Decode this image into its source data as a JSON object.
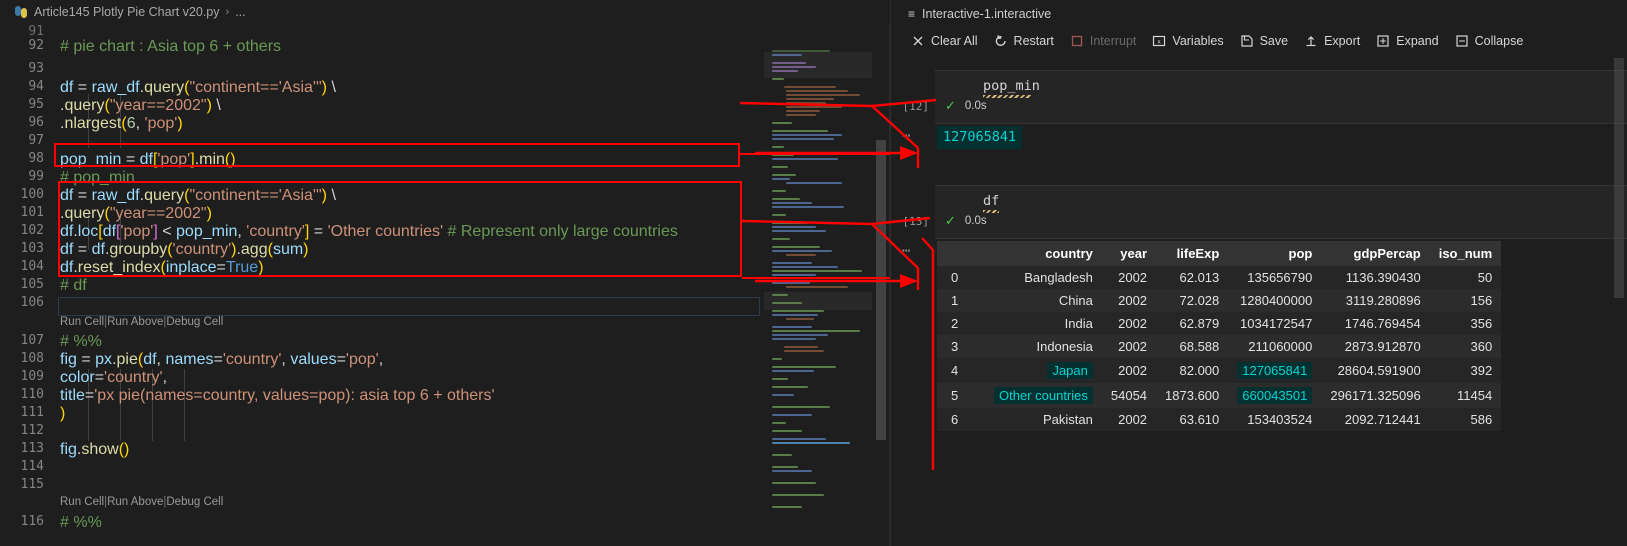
{
  "editor": {
    "breadcrumb": {
      "file": "Article145 Plotly Pie Chart v20.py",
      "separator": "›",
      "more": "..."
    },
    "first_line_number": 91,
    "lines": [
      {
        "n": "91",
        "html_key": "l91"
      },
      {
        "n": "92",
        "html_key": "l92"
      },
      {
        "n": "93",
        "html_key": "l93"
      },
      {
        "n": "94",
        "html_key": "l94"
      },
      {
        "n": "95",
        "html_key": "l95"
      },
      {
        "n": "96",
        "html_key": "l96"
      },
      {
        "n": "97",
        "html_key": "l97"
      },
      {
        "n": "98",
        "html_key": "l98"
      },
      {
        "n": "99",
        "html_key": "l99"
      },
      {
        "n": "100",
        "html_key": "l100"
      },
      {
        "n": "101",
        "html_key": "l101"
      },
      {
        "n": "102",
        "html_key": "l102"
      },
      {
        "n": "103",
        "html_key": "l103"
      },
      {
        "n": "104",
        "html_key": "l104"
      },
      {
        "n": "105",
        "html_key": "l105"
      },
      {
        "n": "106",
        "html_key": "l106"
      },
      {
        "n": "107",
        "html_key": "l107"
      },
      {
        "n": "108",
        "html_key": "l108"
      },
      {
        "n": "109",
        "html_key": "l109"
      },
      {
        "n": "110",
        "html_key": "l110"
      },
      {
        "n": "111",
        "html_key": "l111"
      },
      {
        "n": "112",
        "html_key": "l112"
      },
      {
        "n": "113",
        "html_key": "l113"
      },
      {
        "n": "114",
        "html_key": "l114"
      },
      {
        "n": "115",
        "html_key": "l115"
      },
      {
        "n": "116",
        "html_key": "l116"
      }
    ],
    "source": {
      "l92": "# pie chart : Asia top 6 + others",
      "l94": "df = raw_df.query(\"continent=='Asia'\") \\",
      "l95": "        .query(\"year==2002\") \\",
      "l96": "        .nlargest(6, 'pop')",
      "l98": "pop_min = df['pop'].min()",
      "l99": "# pop_min",
      "l100": "df = raw_df.query(\"continent=='Asia'\") \\",
      "l101": "        .query(\"year==2002\")",
      "l102": "df.loc[df['pop'] < pop_min, 'country'] = 'Other countries' # Represent only large countries",
      "l103": "df = df.groupby('country').agg(sum)",
      "l104": "df.reset_index(inplace=True)",
      "l105": "# df",
      "l107": "# %%",
      "l108": "fig = px.pie(df, names='country', values='pop',",
      "l109": "             color='country',",
      "l110": "             title='px pie(names=country, values=pop): asia top 6 + others'",
      "l111": "             )",
      "l113": "fig.show()",
      "l116": "# %%"
    },
    "codelens": {
      "run_cell": "Run Cell",
      "run_above": "Run Above",
      "debug_cell": "Debug Cell",
      "separator": "|"
    }
  },
  "interactive": {
    "title": "Interactive-1.interactive",
    "toolbar": [
      {
        "label": "Clear All",
        "icon": "close-x-icon",
        "disabled": false
      },
      {
        "label": "Restart",
        "icon": "restart-icon",
        "disabled": false
      },
      {
        "label": "Interrupt",
        "icon": "stop-square-icon",
        "disabled": true
      },
      {
        "label": "Variables",
        "icon": "variables-icon",
        "disabled": false
      },
      {
        "label": "Save",
        "icon": "save-icon",
        "disabled": false
      },
      {
        "label": "Export",
        "icon": "export-icon",
        "disabled": false
      },
      {
        "label": "Expand",
        "icon": "expand-icon",
        "disabled": false
      },
      {
        "label": "Collapse",
        "icon": "collapse-icon",
        "disabled": false
      }
    ],
    "cells": [
      {
        "code": "pop_min",
        "exec_count": "[12]",
        "duration": "0.0s",
        "status_icon": "check-icon",
        "overflow_icon": "more-dots-icon",
        "output_type": "scalar",
        "output_value": "127065841"
      },
      {
        "code": "df",
        "exec_count": "[13]",
        "duration": "0.0s",
        "status_icon": "check-icon",
        "overflow_icon": "more-dots-icon",
        "output_type": "table"
      }
    ],
    "dataframe": {
      "columns": [
        "",
        "country",
        "year",
        "lifeExp",
        "pop",
        "gdpPercap",
        "iso_num"
      ],
      "rows": [
        {
          "cells": [
            "0",
            "Bangladesh",
            "2002",
            "62.013",
            "135656790",
            "1136.390430",
            "50"
          ],
          "highlight": []
        },
        {
          "cells": [
            "1",
            "China",
            "2002",
            "72.028",
            "1280400000",
            "3119.280896",
            "156"
          ],
          "highlight": []
        },
        {
          "cells": [
            "2",
            "India",
            "2002",
            "62.879",
            "1034172547",
            "1746.769454",
            "356"
          ],
          "highlight": []
        },
        {
          "cells": [
            "3",
            "Indonesia",
            "2002",
            "68.588",
            "211060000",
            "2873.912870",
            "360"
          ],
          "highlight": []
        },
        {
          "cells": [
            "4",
            "Japan",
            "2002",
            "82.000",
            "127065841",
            "28604.591900",
            "392"
          ],
          "highlight": [
            1,
            4
          ]
        },
        {
          "cells": [
            "5",
            "Other countries",
            "54054",
            "1873.600",
            "660043501",
            "296171.325096",
            "11454"
          ],
          "highlight": [
            1,
            4
          ]
        },
        {
          "cells": [
            "6",
            "Pakistan",
            "2002",
            "63.610",
            "153403524",
            "2092.712441",
            "586"
          ],
          "highlight": []
        }
      ]
    }
  },
  "annotations": {
    "color": "#ff0000",
    "boxes": [
      {
        "name": "highlight-box-pop-min"
      },
      {
        "name": "highlight-box-df-block"
      }
    ],
    "arrows": [
      {
        "name": "arrow-pop-min-to-output"
      },
      {
        "name": "arrow-df-to-output"
      }
    ]
  },
  "theme": {
    "bg": "#1e1e1e",
    "panel_bg": "#252526",
    "accent_teal": "#0ad1d1",
    "accent_teal_bg": "#04312f",
    "annotation_red": "#ff0000",
    "success_green": "#4ec94e"
  }
}
